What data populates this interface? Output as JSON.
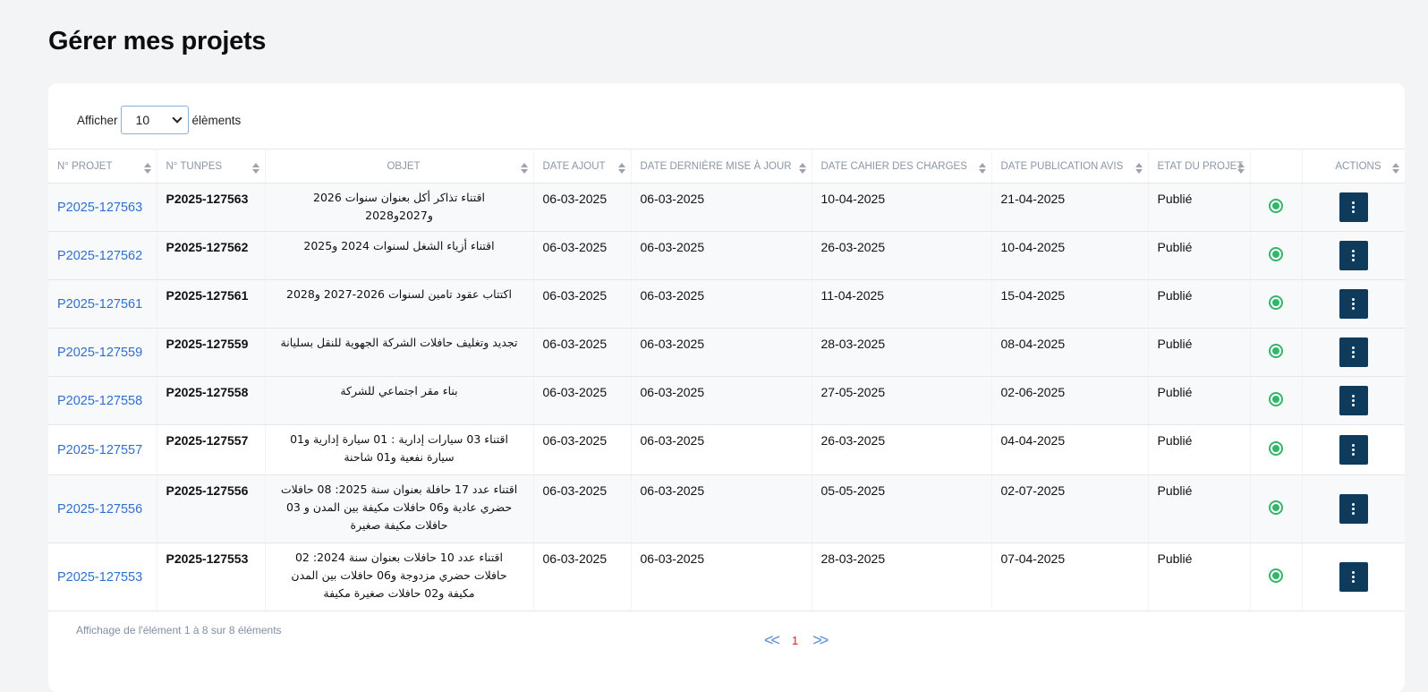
{
  "page": {
    "title": "Gérer mes projets"
  },
  "length": {
    "prefix": "Afficher",
    "value": "10",
    "suffix": "élèments"
  },
  "columns": [
    "N° PROJET",
    "N° TUNPES",
    "OBJET",
    "DATE AJOUT",
    "DATE DERNIÈRE MISE À JOUR",
    "DATE CAHIER DES CHARGES",
    "DATE PUBLICATION AVIS",
    "ETAT DU PROJET",
    "",
    "ACTIONS"
  ],
  "rows": [
    {
      "projet": "P2025-127563",
      "tunpes": "P2025-127563",
      "objet": "اقتناء تذاكر أكل بعنوان سنوات 2026 و2027و2028",
      "date_ajout": "06-03-2025",
      "date_maj": "06-03-2025",
      "date_cahier": "10-04-2025",
      "date_pub": "21-04-2025",
      "etat": "Publié"
    },
    {
      "projet": "P2025-127562",
      "tunpes": "P2025-127562",
      "objet": "اقتناء أزياء الشغل لسنوات 2024 و2025",
      "date_ajout": "06-03-2025",
      "date_maj": "06-03-2025",
      "date_cahier": "26-03-2025",
      "date_pub": "10-04-2025",
      "etat": "Publié"
    },
    {
      "projet": "P2025-127561",
      "tunpes": "P2025-127561",
      "objet": "اكتتاب عقود تامين لسنوات 2026-2027 و2028",
      "date_ajout": "06-03-2025",
      "date_maj": "06-03-2025",
      "date_cahier": "11-04-2025",
      "date_pub": "15-04-2025",
      "etat": "Publié"
    },
    {
      "projet": "P2025-127559",
      "tunpes": "P2025-127559",
      "objet": "تجديد وتغليف حافلات الشركة الجهوية للنقل بسليانة",
      "date_ajout": "06-03-2025",
      "date_maj": "06-03-2025",
      "date_cahier": "28-03-2025",
      "date_pub": "08-04-2025",
      "etat": "Publié"
    },
    {
      "projet": "P2025-127558",
      "tunpes": "P2025-127558",
      "objet": "بناء مقر اجتماعي للشركة",
      "date_ajout": "06-03-2025",
      "date_maj": "06-03-2025",
      "date_cahier": "27-05-2025",
      "date_pub": "02-06-2025",
      "etat": "Publié"
    },
    {
      "projet": "P2025-127557",
      "tunpes": "P2025-127557",
      "objet": "اقتناء 03 سيارات إدارية : 01 سيارة إدارية و01 سيارة نفعية و01 شاحنة",
      "date_ajout": "06-03-2025",
      "date_maj": "06-03-2025",
      "date_cahier": "26-03-2025",
      "date_pub": "04-04-2025",
      "etat": "Publié"
    },
    {
      "projet": "P2025-127556",
      "tunpes": "P2025-127556",
      "objet": "اقتناء عدد 17 حافلة بعنوان سنة 2025: 08 حافلات حضري عادية و06 حافلات مكيفة بين المدن و 03 حافلات مكيفة صغيرة",
      "date_ajout": "06-03-2025",
      "date_maj": "06-03-2025",
      "date_cahier": "05-05-2025",
      "date_pub": "02-07-2025",
      "etat": "Publié"
    },
    {
      "projet": "P2025-127553",
      "tunpes": "P2025-127553",
      "objet": "اقتناء عدد 10 حافلات بعنوان سنة 2024: 02 حافلات حضري مزدوجة و06 حافلات بين المدن مكيفة و02 حافلات صغيرة مكيفة",
      "date_ajout": "06-03-2025",
      "date_maj": "06-03-2025",
      "date_cahier": "28-03-2025",
      "date_pub": "07-04-2025",
      "etat": "Publié"
    }
  ],
  "footer": {
    "info": "Affichage de l'élément 1 à 8 sur 8 éléments"
  },
  "pagination": {
    "prev": "<<",
    "current": "1",
    "next": ">>"
  },
  "colors": {
    "link": "#2f6fd0",
    "action_button": "#0e3a5c",
    "status_dot": "#34b56a",
    "current_page": "#e02020"
  },
  "icons": {
    "status": "published-status-icon",
    "actions": "kebab-menu-icon",
    "sort": "sort-icon"
  }
}
